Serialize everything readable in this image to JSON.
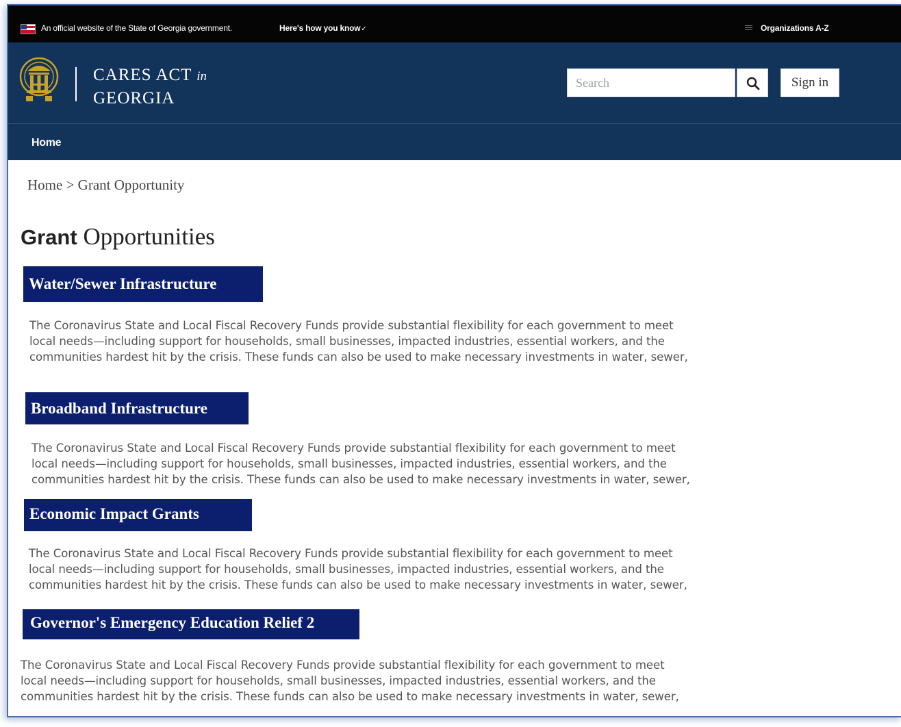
{
  "gov_banner": {
    "official_text": "An official website of the State of Georgia government.",
    "how_you_know": "Here's how you know",
    "organizations": "Organizations A-Z"
  },
  "header": {
    "title_line1": "CARES ACT",
    "title_in": "in",
    "title_line2": "GEORGIA",
    "search_placeholder": "Search",
    "sign_in": "Sign in"
  },
  "nav": {
    "home": "Home"
  },
  "breadcrumb": {
    "home": "Home",
    "separator": " > ",
    "current": "Grant Opportunity"
  },
  "page_title": {
    "part1": "Grant",
    "part2": "Opportunities"
  },
  "grants": [
    {
      "title": "Water/Sewer Infrastructure",
      "lines": [
        "The Coronavirus State and Local Fiscal Recovery Funds provide substantial flexibility for each government to meet",
        "local needs—including support for households, small businesses, impacted industries, essential workers, and the",
        "communities hardest hit by the crisis. These funds can also be used to make necessary investments in water, sewer,"
      ]
    },
    {
      "title": "Broadband Infrastructure",
      "lines": [
        "The Coronavirus State and Local Fiscal Recovery Funds provide substantial flexibility for each government to meet",
        "local needs—including support for households, small businesses, impacted industries, essential workers, and the",
        "communities hardest hit by the crisis. These funds can also be used to make necessary investments in water, sewer,"
      ]
    },
    {
      "title": "Economic Impact Grants",
      "lines": [
        "The Coronavirus State and Local Fiscal Recovery Funds provide substantial flexibility for each government to meet",
        "local needs—including support for households, small businesses, impacted industries, essential workers, and the",
        "communities hardest hit by the crisis. These funds can also be used to make necessary investments in water, sewer,"
      ]
    },
    {
      "title": "Governor's Emergency Education Relief 2",
      "lines": [
        "The Coronavirus State and Local Fiscal Recovery Funds provide substantial flexibility for each government to meet",
        "local needs—including support for households, small businesses, impacted industries, essential workers, and the",
        "communities hardest hit by the crisis. These funds can also be used to make necessary investments in water, sewer,"
      ]
    }
  ],
  "colors": {
    "banner_bg": "#050505",
    "header_bg": "#12335a",
    "grant_heading_bg": "#0c1f6e",
    "body_text": "#555555"
  },
  "icons": {
    "flag": "us-flag-icon",
    "chevron": "chevron-down-icon",
    "organizations": "grid-icon",
    "seal": "georgia-seal-icon",
    "search": "search-icon"
  }
}
